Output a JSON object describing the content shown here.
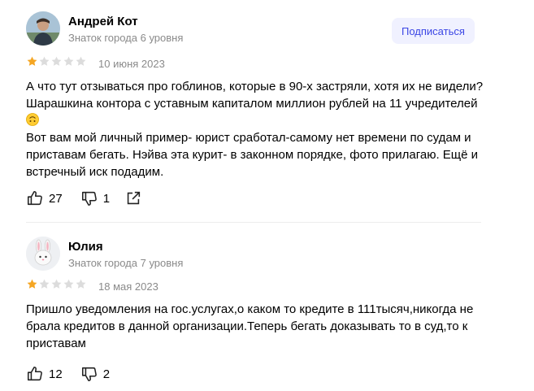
{
  "reviews": [
    {
      "author": "Андрей Кот",
      "level": "Знаток города 6 уровня",
      "subscribe_label": "Подписаться",
      "rating": 1,
      "rating_max": 5,
      "date": "10 июня 2023",
      "text_part1": "А что тут отзываться про гоблинов, которые в 90-х застряли, хотя их не видели? Шарашкина контора с уставным капиталом миллион рублей на 11 учредителей",
      "text_part2": "\nВот вам мой личный пример- юрист сработал-самому нет времени по судам и приставам бегать. Нэйва эта курит- в законном порядке, фото прилагаю. Ещё и встречный иск подадим.",
      "likes": "27",
      "dislikes": "1",
      "icons": [
        "avatar-photo",
        "upside-down-face-emoji",
        "thumbs-up-icon",
        "thumbs-down-icon",
        "share-icon"
      ]
    },
    {
      "author": "Юлия",
      "level": "Знаток города 7 уровня",
      "rating": 1,
      "rating_max": 5,
      "date": "18 мая 2023",
      "text": "Пришло уведомления на гос.услугах,о каком то кредите в 111тысяч,никогда не брала кредитов в данной организации.Теперь бегать доказывать то в суд,то к приставам",
      "likes": "12",
      "dislikes": "2",
      "icons": [
        "bunny-avatar",
        "thumbs-up-icon",
        "thumbs-down-icon"
      ]
    }
  ],
  "colors": {
    "star_filled": "#f5a623",
    "star_empty": "#dcdcdc",
    "subscribe_bg": "#f0f1ff",
    "subscribe_text": "#3b46e5",
    "muted_text": "#8a8a8a"
  }
}
